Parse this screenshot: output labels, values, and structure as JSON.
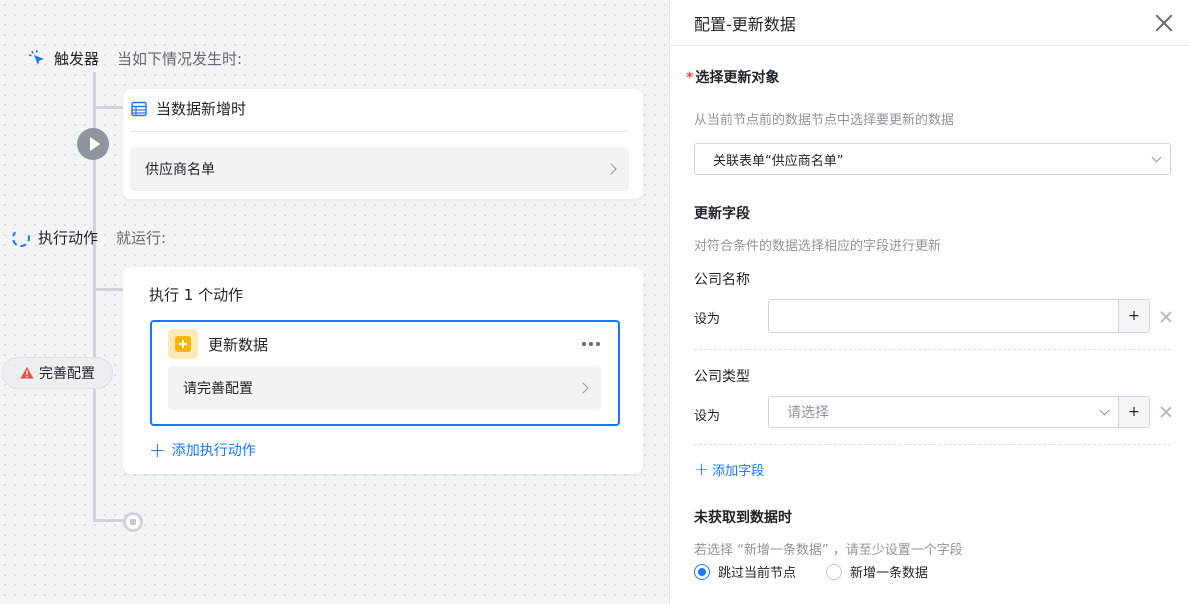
{
  "canvas": {
    "trigger": {
      "name": "触发器",
      "desc": "当如下情况发生时:"
    },
    "trigger_card": {
      "title": "当数据新增时",
      "row": "供应商名单"
    },
    "action_section": {
      "name": "执行动作",
      "desc": "就运行:"
    },
    "warning_badge": "完善配置",
    "action_group": {
      "title": "执行 1 个动作",
      "action": {
        "title": "更新数据",
        "row": "请完善配置"
      },
      "add_action": "添加执行动作"
    }
  },
  "panel": {
    "title": "配置-更新数据",
    "select_target": {
      "required_mark": "*",
      "title": "选择更新对象",
      "hint": "从当前节点前的数据节点中选择要更新的数据",
      "value": "关联表单“供应商名单”"
    },
    "update_fields": {
      "title": "更新字段",
      "hint": "对符合条件的数据选择相应的字段进行更新",
      "fields": [
        {
          "label": "公司名称",
          "set_label": "设为",
          "value": "",
          "plus": "+"
        },
        {
          "label": "公司类型",
          "set_label": "设为",
          "placeholder": "请选择",
          "plus": "+"
        }
      ],
      "add_field": "添加字段"
    },
    "no_data": {
      "title": "未获取到数据时",
      "hint": "若选择 “新增一条数据” ，请至少设置一个字段",
      "options": [
        {
          "label": "跳过当前节点",
          "selected": true
        },
        {
          "label": "新增一条数据",
          "selected": false
        }
      ]
    }
  },
  "colors": {
    "accent": "#1677ff",
    "warning": "#f54a45",
    "action_icon": "#f7b500"
  }
}
